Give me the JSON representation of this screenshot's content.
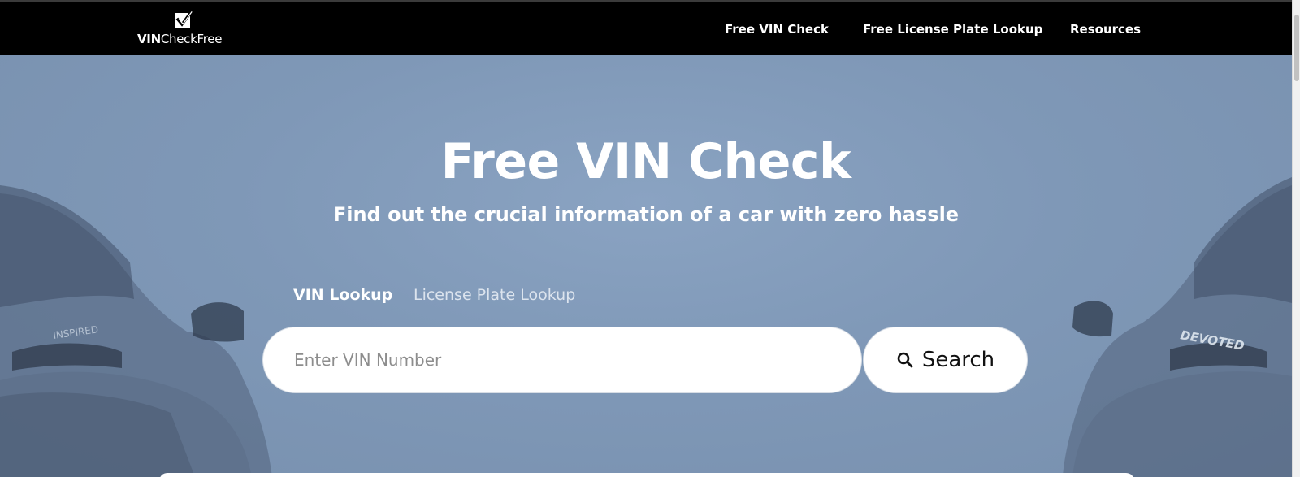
{
  "header": {
    "logo": {
      "bold": "VIN",
      "regular": "CheckFree",
      "icon": "checkbox-check-icon"
    },
    "nav": [
      {
        "label": "Free VIN Check"
      },
      {
        "label": "Free License Plate Lookup"
      },
      {
        "label": "Resources"
      }
    ]
  },
  "hero": {
    "title": "Free VIN Check",
    "subtitle": "Find out the crucial information of a car with zero hassle",
    "tabs": [
      {
        "label": "VIN Lookup",
        "active": true
      },
      {
        "label": "License Plate Lookup",
        "active": false
      }
    ],
    "search": {
      "placeholder": "Enter VIN Number",
      "button_label": "Search",
      "button_icon": "search-icon"
    }
  },
  "colors": {
    "nav_bg": "#000000",
    "hero_bg": "#8aa3c2",
    "text": "#ffffff"
  }
}
